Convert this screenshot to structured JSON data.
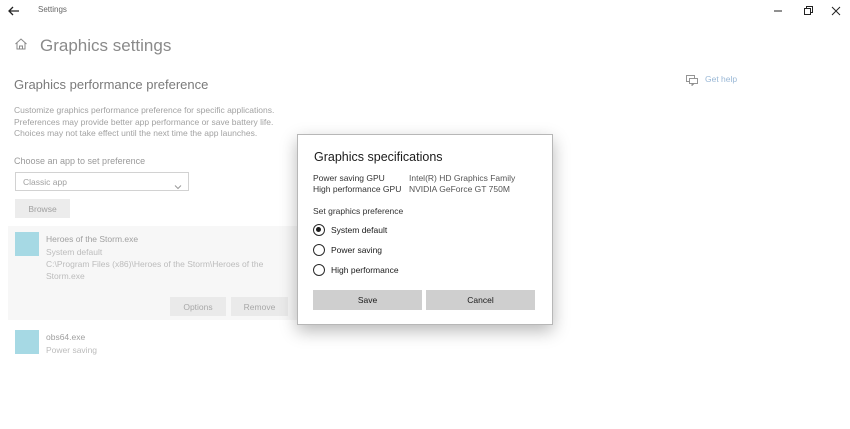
{
  "window": {
    "title": "Settings",
    "controls": [
      "minimize",
      "restore",
      "close"
    ]
  },
  "page": {
    "title": "Graphics settings",
    "section_title": "Graphics performance preference",
    "description_lines": [
      "Customize graphics performance preference for specific applications.",
      "Preferences may provide better app performance or save battery life.",
      "Choices may not take effect until the next time the app launches."
    ],
    "choose_label": "Choose an app to set preference",
    "app_type_select": {
      "value": "Classic app"
    },
    "browse_label": "Browse",
    "help_link": "Get help"
  },
  "apps": [
    {
      "name": "Heroes of the Storm.exe",
      "preference": "System default",
      "path_lines": [
        "C:\\Program Files (x86)\\Heroes of the Storm\\Heroes of the",
        "Storm.exe"
      ],
      "options_label": "Options",
      "remove_label": "Remove",
      "icon_color": "#a6d9e4"
    },
    {
      "name": "obs64.exe",
      "preference": "Power saving",
      "icon_color": "#a6d9e4"
    }
  ],
  "dialog": {
    "title": "Graphics specifications",
    "specs": [
      {
        "label": "Power saving GPU",
        "value": "Intel(R) HD Graphics Family"
      },
      {
        "label": "High performance GPU",
        "value": "NVIDIA GeForce GT 750M"
      }
    ],
    "set_label": "Set graphics preference",
    "options": [
      {
        "label": "System default",
        "selected": true
      },
      {
        "label": "Power saving",
        "selected": false
      },
      {
        "label": "High performance",
        "selected": false
      }
    ],
    "save_label": "Save",
    "cancel_label": "Cancel"
  }
}
